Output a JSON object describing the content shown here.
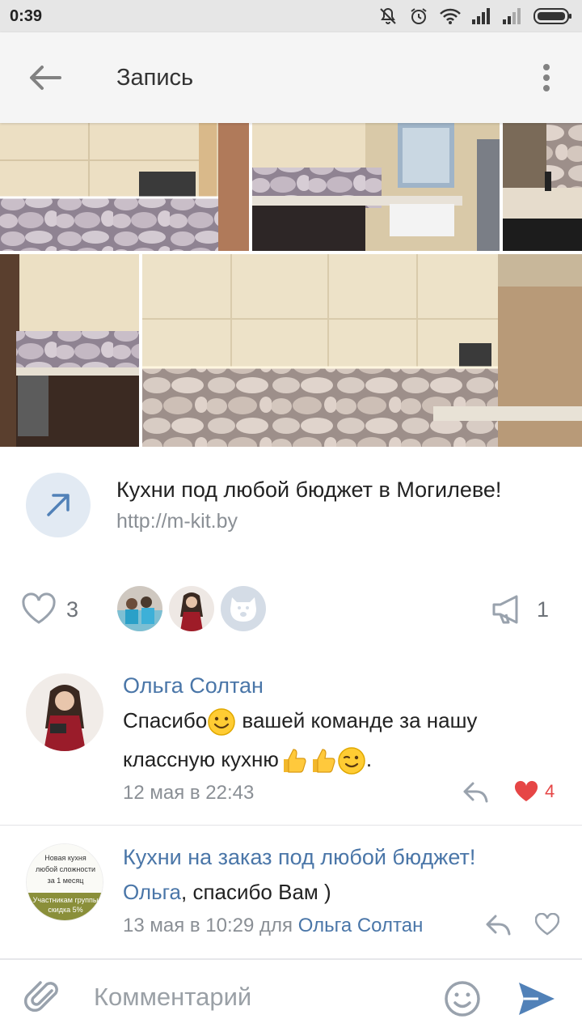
{
  "status_bar": {
    "time": "0:39",
    "icons": [
      "mute-icon",
      "alarm-icon",
      "wifi-icon",
      "signal-icon",
      "signal-icon",
      "battery-icon"
    ]
  },
  "header": {
    "title": "Запись",
    "back_icon": "arrow-left-icon",
    "menu_icon": "more-vert-icon"
  },
  "link_attachment": {
    "title": "Кухни под любой бюджет в Могилеве!",
    "url": "http://m-kit.by",
    "icon": "arrow-up-right-icon"
  },
  "reactions": {
    "likes_count": "3",
    "shares_count": "1",
    "liker_avatars": [
      "family-photo",
      "woman-photo",
      "dog-deactivated-icon"
    ]
  },
  "comments": [
    {
      "author": "Ольга Солтан",
      "text_part1": "Спасибо",
      "text_part2": " вашей команде за нашу классную кухню",
      "text_part3": ".",
      "timestamp": "12 мая в 22:43",
      "likes": "4"
    },
    {
      "author": "Кухни на заказ под любой бюджет!",
      "mention": "Ольга",
      "text": ", спасибо Вам )",
      "timestamp": "13 мая в 10:29 для",
      "reply_to": "Ольга Солтан",
      "avatar_lines": [
        "Новая кухня",
        "любой сложности",
        "за 1 месяц",
        "Участникам группы",
        "скидка 5%"
      ]
    }
  ],
  "composer": {
    "placeholder": "Комментарий"
  },
  "colors": {
    "accent": "#4a76a8",
    "like_red": "#e64646",
    "icon_gray": "#99a2ad"
  }
}
